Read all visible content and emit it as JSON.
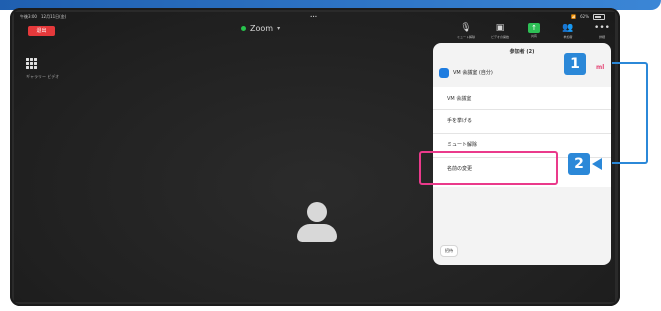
{
  "status_bar": {
    "left": "午後3:00　12月11日(金)",
    "center": "•••",
    "right": "62%"
  },
  "meeting": {
    "leave_label": "退出",
    "title": "Zoom"
  },
  "toolbar": {
    "items": [
      {
        "label": "ミュート解除",
        "icon": "mic-off-icon"
      },
      {
        "label": "ビデオの開始",
        "icon": "video-off-icon"
      },
      {
        "label": "共有",
        "icon": "share-icon"
      },
      {
        "label": "参加者",
        "icon": "participants-icon"
      },
      {
        "label": "詳細",
        "icon": "more-icon"
      }
    ]
  },
  "sidebar": {
    "label": "ギャラリー\nビデオ"
  },
  "panel": {
    "title": "参加者 (2)",
    "me_name": "VM 会議室 (自分)",
    "menu_title": "VM 会議室",
    "menu_items": [
      {
        "label": "手を挙げる"
      },
      {
        "label": "ミュート解除"
      },
      {
        "label": "名前の変更"
      }
    ],
    "invite_label": "招待"
  },
  "callouts": {
    "one": "1",
    "two": "2",
    "marker": "ml"
  },
  "colors": {
    "accent": "#2b88d8",
    "highlight": "#ea3a8b",
    "leave": "#e5393b",
    "share": "#2dbf55"
  }
}
